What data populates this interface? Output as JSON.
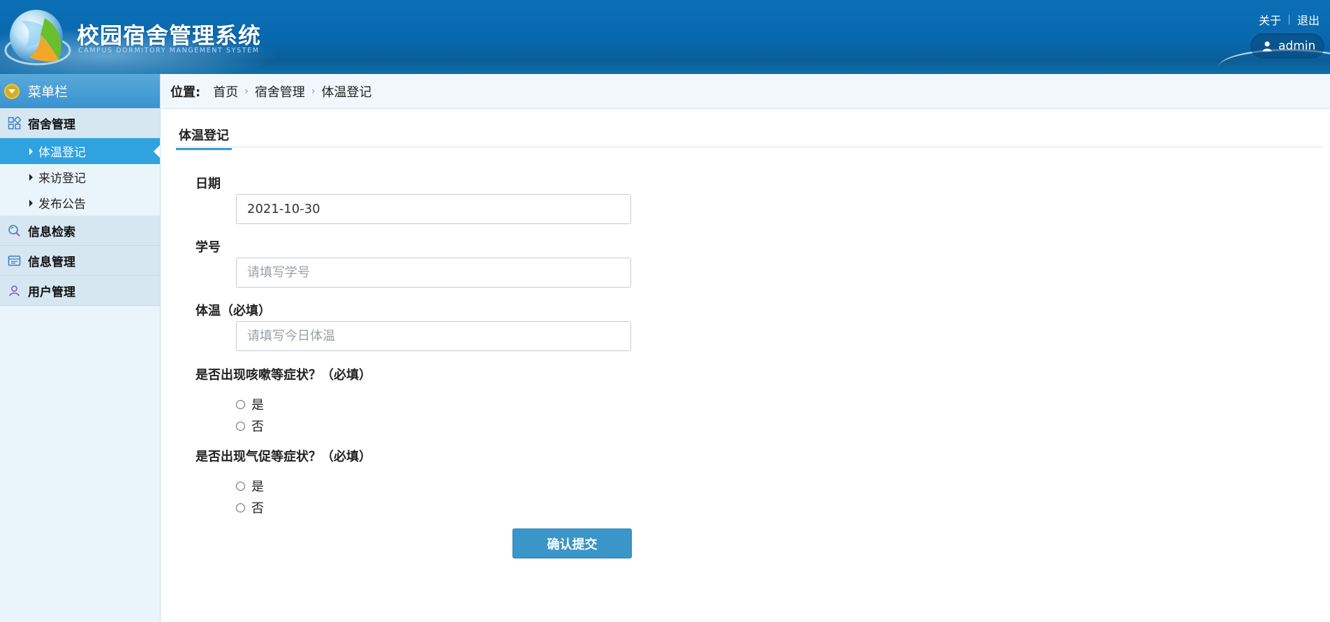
{
  "header": {
    "title": "校园宿舍管理系统",
    "subtitle": "CAMPUS DORMITORY MANGEMENT SYSTEM",
    "links": {
      "about": "关于",
      "logout": "退出"
    },
    "user": "admin",
    "icons": [
      "globe-logo-icon",
      "user-icon"
    ]
  },
  "sidebar": {
    "menu_title": "菜单栏",
    "groups": [
      {
        "label": "宿舍管理",
        "icon": "grid-icon",
        "items": [
          {
            "label": "体温登记",
            "active": true
          },
          {
            "label": "来访登记",
            "active": false
          },
          {
            "label": "发布公告",
            "active": false
          }
        ]
      },
      {
        "label": "信息检索",
        "icon": "search-icon"
      },
      {
        "label": "信息管理",
        "icon": "panel-icon"
      },
      {
        "label": "用户管理",
        "icon": "user-icon"
      }
    ]
  },
  "breadcrumb": {
    "label": "位置:",
    "items": [
      "首页",
      "宿舍管理",
      "体温登记"
    ]
  },
  "form": {
    "tab_title": "体温登记",
    "date": {
      "label": "日期",
      "value": "2021-10-30"
    },
    "student_id": {
      "label": "学号",
      "placeholder": "请填写学号"
    },
    "temperature": {
      "label": "体温（必填）",
      "placeholder": "请填写今日体温"
    },
    "cough": {
      "label": "是否出现咳嗽等症状？（必填）",
      "options": [
        "是",
        "否"
      ]
    },
    "breath": {
      "label": "是否出现气促等症状？（必填）",
      "options": [
        "是",
        "否"
      ]
    },
    "submit_label": "确认提交"
  },
  "colors": {
    "header_blue": "#0868ae",
    "accent": "#2fa3e0",
    "button": "#3a95c9"
  }
}
